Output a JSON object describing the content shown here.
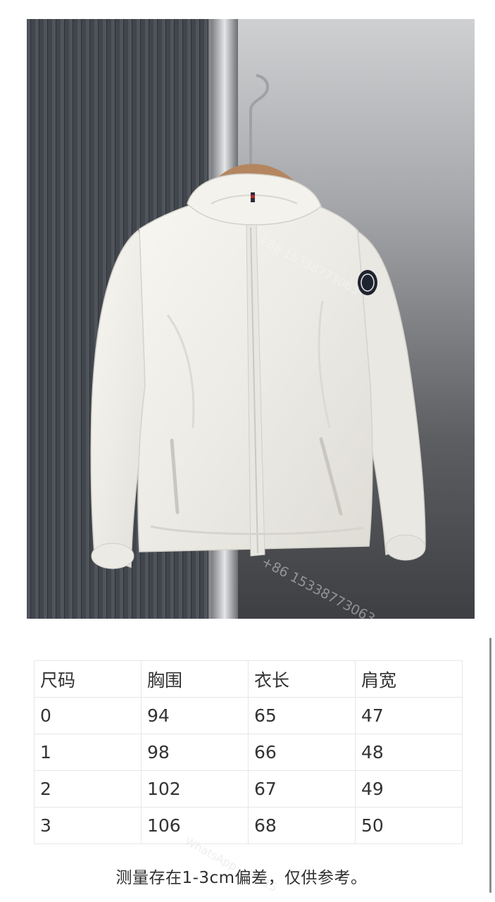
{
  "photo": {
    "subject": "white hooded jacket on hanger",
    "icons": [
      "hanger-icon",
      "sleeve-badge-icon"
    ]
  },
  "size_table": {
    "headers": [
      "尺码",
      "胸围",
      "衣长",
      "肩宽"
    ],
    "rows": [
      [
        "0",
        "94",
        "65",
        "47"
      ],
      [
        "1",
        "98",
        "66",
        "48"
      ],
      [
        "2",
        "102",
        "67",
        "49"
      ],
      [
        "3",
        "106",
        "68",
        "50"
      ]
    ]
  },
  "note": "测量存在1-3cm偏差，仅供参考。",
  "watermarks": [
    "+86 15338773063",
    "+86 15338773063",
    "WhatsApp +86 15"
  ],
  "colors": {
    "table_border": "#e7e7e7",
    "text": "#333333",
    "jacket": "#f2f1ec",
    "background_wall": "#4a4e55"
  }
}
